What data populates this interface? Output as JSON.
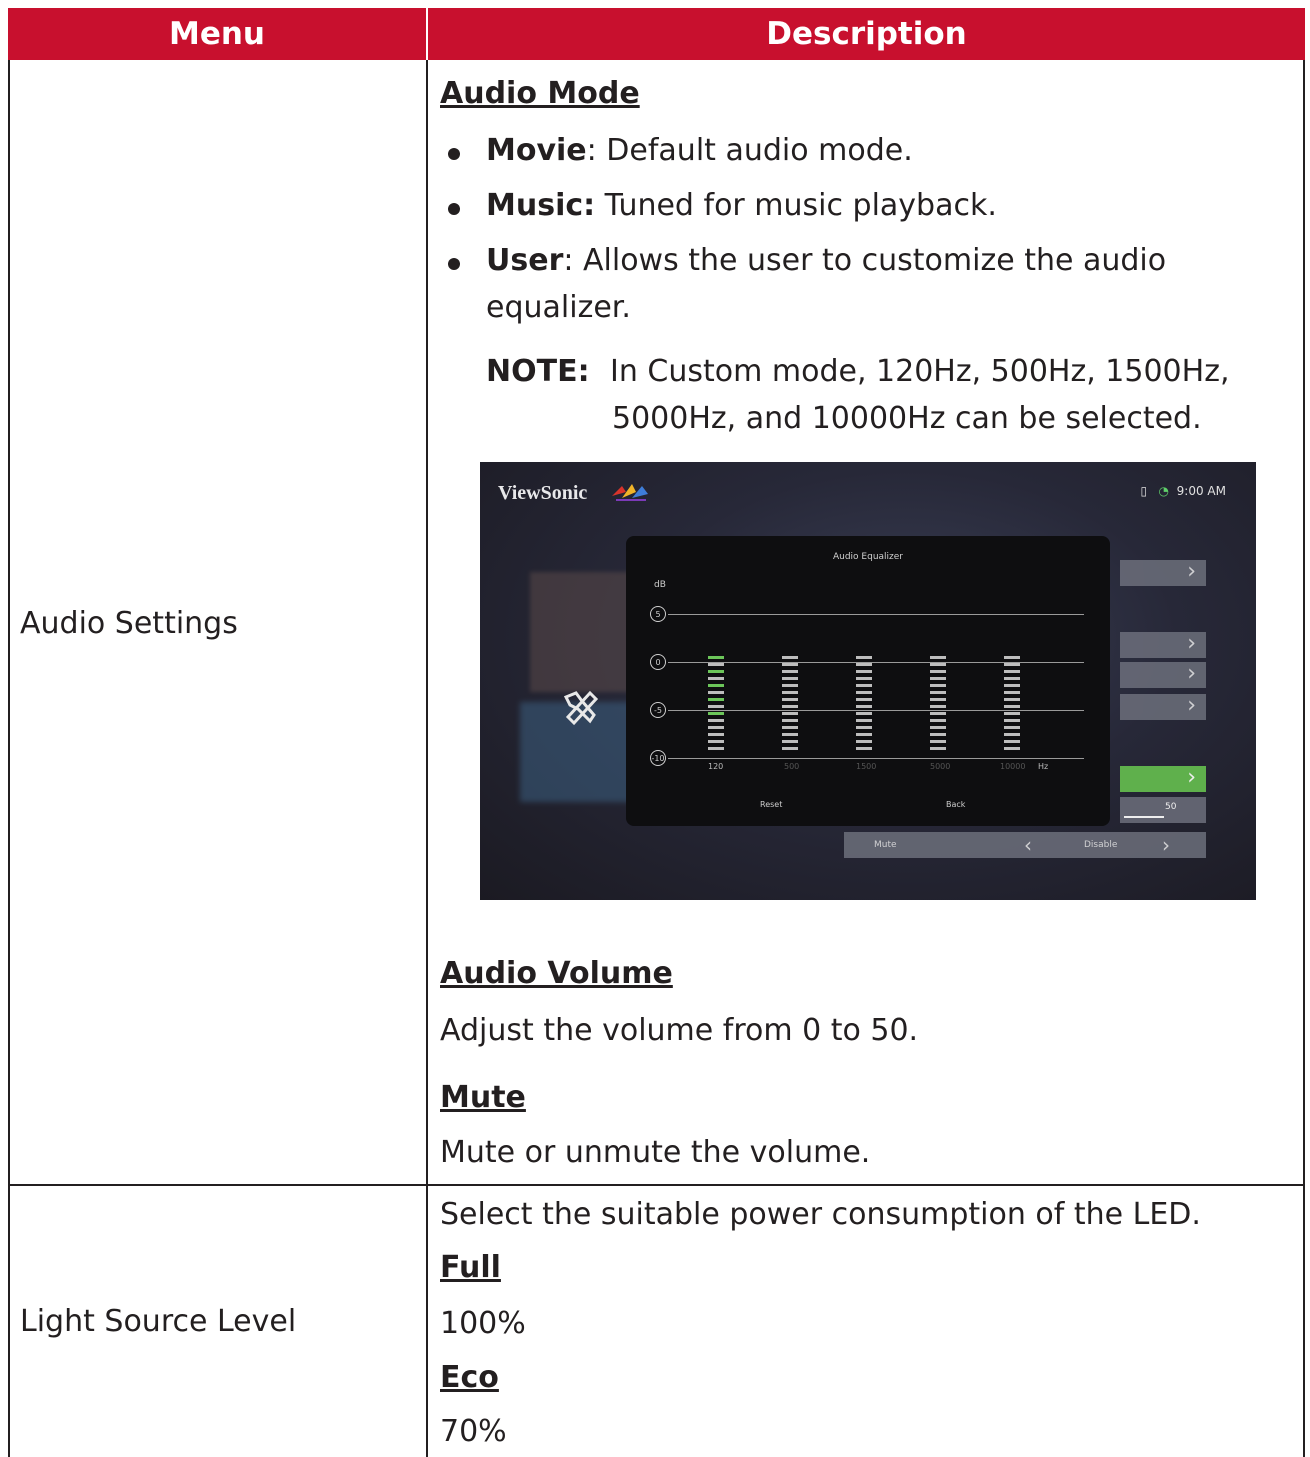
{
  "table": {
    "header": {
      "menu": "Menu",
      "description": "Description"
    },
    "rows": [
      {
        "menu": "Audio Settings",
        "audio_mode": {
          "heading": "Audio Mode",
          "items": [
            {
              "term": "Movie",
              "sep": ":",
              "desc": " Default audio mode."
            },
            {
              "term": "Music:",
              "sep": "",
              "desc": " Tuned for music playback."
            },
            {
              "term": "User",
              "sep": ":",
              "desc": " Allows the user to customize the audio",
              "desc2": "equalizer."
            }
          ],
          "note_label": "NOTE:",
          "note_line1": "In Custom mode, 120Hz, 500Hz, 1500Hz,",
          "note_line2": "5000Hz, and 10000Hz can be selected."
        },
        "screenshot": {
          "logo": "ViewSonic",
          "status_time": "9:00 AM",
          "eq_title": "Audio Equalizer",
          "db_label": "dB",
          "levels": [
            "5",
            "0",
            "-5",
            "-10"
          ],
          "bands": [
            {
              "label": "120",
              "level": 0.7
            },
            {
              "label": "500",
              "level": 0.0
            },
            {
              "label": "1500",
              "level": 0.0
            },
            {
              "label": "5000",
              "level": 0.0
            },
            {
              "label": "10000",
              "level": 0.0
            }
          ],
          "hz_label": "Hz",
          "reset": "Reset",
          "back": "Back",
          "volume_value": "50",
          "mute_label": "Mute",
          "mute_value": "Disable",
          "chevron_right": "›",
          "chevron_left": "‹"
        },
        "audio_volume": {
          "heading": "Audio Volume",
          "text": "Adjust the volume from 0 to 50."
        },
        "mute": {
          "heading": "Mute",
          "text": "Mute or unmute the volume."
        }
      },
      {
        "menu": "Light Source Level",
        "intro": "Select the suitable power consumption of the LED.",
        "full_heading": "Full",
        "full_value": "100%",
        "eco_heading": "Eco",
        "eco_value": "70%"
      }
    ]
  }
}
